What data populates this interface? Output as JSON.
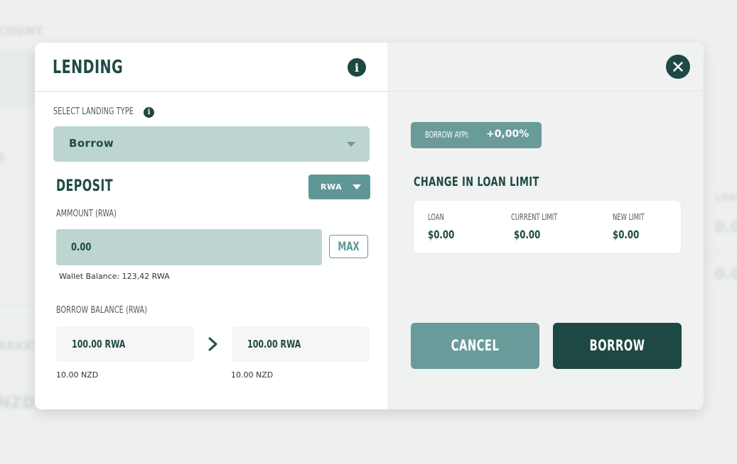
{
  "background": {
    "account_label": "COUNT",
    "market_label": "ARKET",
    "nzd_label": "NZD",
    "loan_label": "LOAN",
    "value1": "0.0",
    "value2": "0.0",
    "s_label": "S"
  },
  "modal": {
    "title": "LENDING",
    "select_label": "SELECT LANDING TYPE",
    "select_value": "Borrow",
    "deposit_heading": "DEPOSIT",
    "currency_button": "RWA",
    "amount_label": "AMMOUNT (RWA)",
    "amount_value": "0.00",
    "max_label": "MAX",
    "wallet_balance": "Wallet Balance: 123,42 RWA",
    "borrow_balance_label": "BORROW BALANCE  (RWA)",
    "balance_from": {
      "value": "100.00 RWA",
      "fiat": "10.00 NZD"
    },
    "balance_to": {
      "value": "100.00 RWA",
      "fiat": "10.00 NZD"
    },
    "borrow_apy_label": "BORROW AYPI:",
    "borrow_apy_value": "+0,00%",
    "change_heading": "CHANGE IN LOAN LIMIT",
    "limits": {
      "loan_label": "LOAN",
      "loan_value": "$0.00",
      "current_label": "CURRENT LIMIT",
      "current_value": "$0.00",
      "new_label": "NEW LIMIT",
      "new_value": "$0.00"
    },
    "cancel_label": "CANCEL",
    "borrow_label": "BORROW"
  },
  "colors": {
    "primary_dark": "#1d4843",
    "accent": "#6a9b9b",
    "input_bg": "#bcd5d0"
  },
  "icons": [
    "info-icon",
    "chevron-down-icon",
    "arrow-right-icon",
    "close-icon"
  ]
}
